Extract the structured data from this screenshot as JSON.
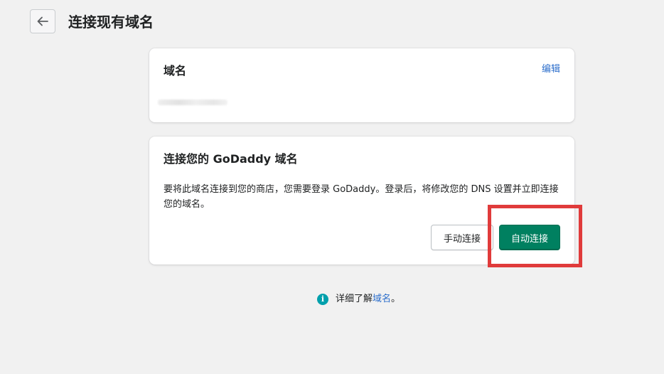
{
  "header": {
    "title": "连接现有域名"
  },
  "domain_card": {
    "title": "域名",
    "edit_label": "编辑"
  },
  "connect_card": {
    "title": "连接您的 GoDaddy 域名",
    "description": "要将此域名连接到您的商店，您需要登录 GoDaddy。登录后，将修改您的 DNS 设置并立即连接您的域名。",
    "manual_label": "手动连接",
    "auto_label": "自动连接"
  },
  "footer": {
    "info_glyph": "i",
    "prefix": "详细了解",
    "link": "域名",
    "suffix": "。"
  },
  "colors": {
    "primary": "#008060",
    "link": "#2c6ecb",
    "highlight": "#e03b3b",
    "info": "#00a0ac"
  }
}
